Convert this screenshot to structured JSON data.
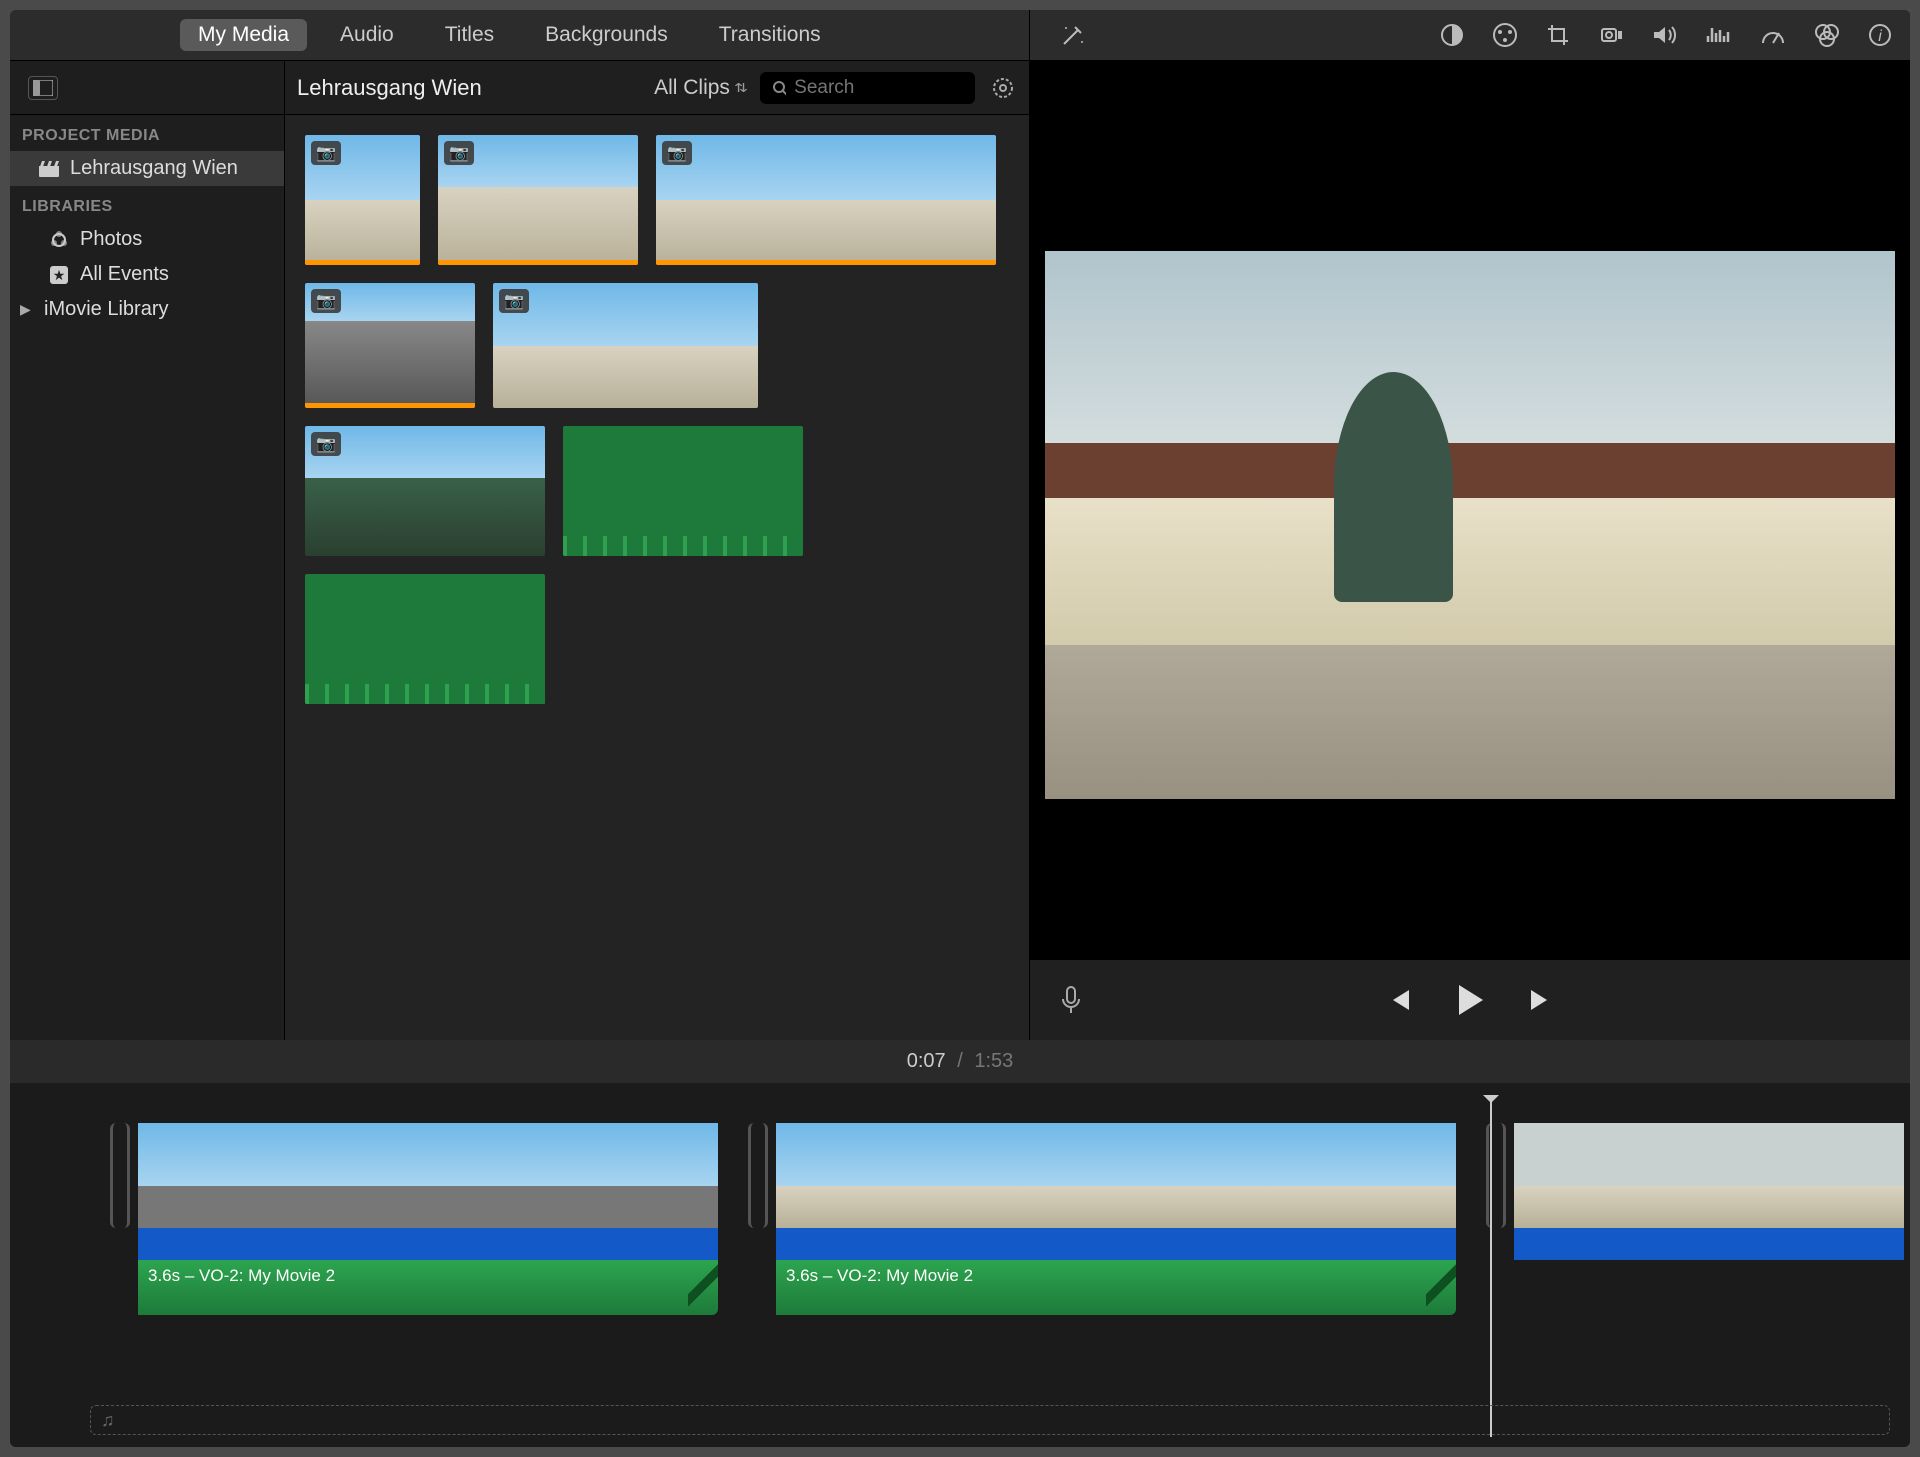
{
  "tabs": [
    "My Media",
    "Audio",
    "Titles",
    "Backgrounds",
    "Transitions"
  ],
  "active_tab": 0,
  "sidebar": {
    "section1": "PROJECT MEDIA",
    "project": "Lehrausgang Wien",
    "section2": "LIBRARIES",
    "photos": "Photos",
    "all_events": "All Events",
    "library": "iMovie Library"
  },
  "browser": {
    "event_name": "Lehrausgang Wien",
    "filter": "All Clips",
    "search_placeholder": "Search"
  },
  "viewer_tools": [
    "enhance-icon",
    "contrast-icon",
    "color-icon",
    "crop-icon",
    "stabilize-icon",
    "volume-icon",
    "noise-icon",
    "speed-icon",
    "filters-icon",
    "info-icon"
  ],
  "playhead_time": "0:07",
  "total_time": "1:53",
  "timeline": {
    "vo_label_1": "3.6s – VO-2: My Movie 2",
    "vo_label_2": "3.6s – VO-2: My Movie 2"
  },
  "music_icon": "♫"
}
